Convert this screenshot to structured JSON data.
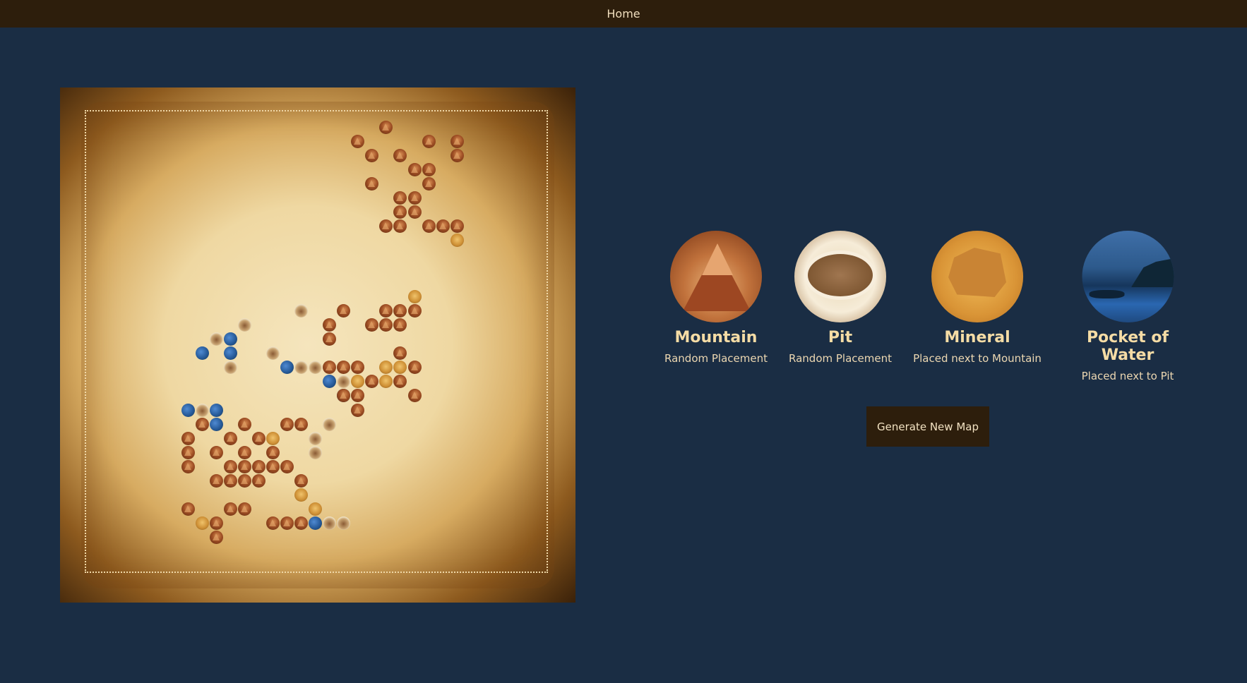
{
  "nav": {
    "home_label": "Home"
  },
  "map": {
    "tiles": [
      {
        "t": "mountain",
        "c": 18,
        "r": 0
      },
      {
        "t": "mountain",
        "c": 16,
        "r": 1
      },
      {
        "t": "mountain",
        "c": 21,
        "r": 1
      },
      {
        "t": "mountain",
        "c": 23,
        "r": 1
      },
      {
        "t": "mountain",
        "c": 17,
        "r": 2
      },
      {
        "t": "mountain",
        "c": 19,
        "r": 2
      },
      {
        "t": "mountain",
        "c": 23,
        "r": 2
      },
      {
        "t": "mountain",
        "c": 20,
        "r": 3
      },
      {
        "t": "mountain",
        "c": 21,
        "r": 3
      },
      {
        "t": "mountain",
        "c": 17,
        "r": 4
      },
      {
        "t": "mountain",
        "c": 21,
        "r": 4
      },
      {
        "t": "mountain",
        "c": 19,
        "r": 5
      },
      {
        "t": "mountain",
        "c": 20,
        "r": 5
      },
      {
        "t": "mountain",
        "c": 19,
        "r": 6
      },
      {
        "t": "mountain",
        "c": 20,
        "r": 6
      },
      {
        "t": "mountain",
        "c": 18,
        "r": 7
      },
      {
        "t": "mountain",
        "c": 19,
        "r": 7
      },
      {
        "t": "mountain",
        "c": 21,
        "r": 7
      },
      {
        "t": "mountain",
        "c": 22,
        "r": 7
      },
      {
        "t": "mountain",
        "c": 23,
        "r": 7
      },
      {
        "t": "mineral",
        "c": 23,
        "r": 8
      },
      {
        "t": "mineral",
        "c": 20,
        "r": 12
      },
      {
        "t": "pit",
        "c": 12,
        "r": 13
      },
      {
        "t": "mountain",
        "c": 15,
        "r": 13
      },
      {
        "t": "mountain",
        "c": 18,
        "r": 13
      },
      {
        "t": "mountain",
        "c": 19,
        "r": 13
      },
      {
        "t": "mountain",
        "c": 20,
        "r": 13
      },
      {
        "t": "pit",
        "c": 8,
        "r": 14
      },
      {
        "t": "mountain",
        "c": 14,
        "r": 14
      },
      {
        "t": "mountain",
        "c": 17,
        "r": 14
      },
      {
        "t": "mountain",
        "c": 18,
        "r": 14
      },
      {
        "t": "mountain",
        "c": 19,
        "r": 14
      },
      {
        "t": "pit",
        "c": 6,
        "r": 15
      },
      {
        "t": "water",
        "c": 7,
        "r": 15
      },
      {
        "t": "mountain",
        "c": 14,
        "r": 15
      },
      {
        "t": "water",
        "c": 5,
        "r": 16
      },
      {
        "t": "water",
        "c": 7,
        "r": 16
      },
      {
        "t": "pit",
        "c": 10,
        "r": 16
      },
      {
        "t": "mountain",
        "c": 19,
        "r": 16
      },
      {
        "t": "pit",
        "c": 7,
        "r": 17
      },
      {
        "t": "water",
        "c": 11,
        "r": 17
      },
      {
        "t": "pit",
        "c": 12,
        "r": 17
      },
      {
        "t": "pit",
        "c": 13,
        "r": 17
      },
      {
        "t": "mountain",
        "c": 14,
        "r": 17
      },
      {
        "t": "mountain",
        "c": 15,
        "r": 17
      },
      {
        "t": "mountain",
        "c": 16,
        "r": 17
      },
      {
        "t": "mineral",
        "c": 18,
        "r": 17
      },
      {
        "t": "mineral",
        "c": 19,
        "r": 17
      },
      {
        "t": "mountain",
        "c": 20,
        "r": 17
      },
      {
        "t": "water",
        "c": 14,
        "r": 18
      },
      {
        "t": "pit",
        "c": 15,
        "r": 18
      },
      {
        "t": "mineral",
        "c": 16,
        "r": 18
      },
      {
        "t": "mountain",
        "c": 17,
        "r": 18
      },
      {
        "t": "mineral",
        "c": 18,
        "r": 18
      },
      {
        "t": "mountain",
        "c": 19,
        "r": 18
      },
      {
        "t": "water",
        "c": 15,
        "r": 19
      },
      {
        "t": "mountain",
        "c": 15,
        "r": 19
      },
      {
        "t": "mountain",
        "c": 16,
        "r": 19
      },
      {
        "t": "mountain",
        "c": 20,
        "r": 19
      },
      {
        "t": "water",
        "c": 4,
        "r": 20
      },
      {
        "t": "pit",
        "c": 5,
        "r": 20
      },
      {
        "t": "water",
        "c": 6,
        "r": 20
      },
      {
        "t": "mountain",
        "c": 16,
        "r": 20
      },
      {
        "t": "mountain",
        "c": 5,
        "r": 21
      },
      {
        "t": "water",
        "c": 6,
        "r": 21
      },
      {
        "t": "mountain",
        "c": 8,
        "r": 21
      },
      {
        "t": "mountain",
        "c": 11,
        "r": 21
      },
      {
        "t": "mountain",
        "c": 12,
        "r": 21
      },
      {
        "t": "pit",
        "c": 14,
        "r": 21
      },
      {
        "t": "mountain",
        "c": 4,
        "r": 22
      },
      {
        "t": "mountain",
        "c": 7,
        "r": 22
      },
      {
        "t": "mountain",
        "c": 9,
        "r": 22
      },
      {
        "t": "mineral",
        "c": 10,
        "r": 22
      },
      {
        "t": "pit",
        "c": 13,
        "r": 22
      },
      {
        "t": "mountain",
        "c": 4,
        "r": 23
      },
      {
        "t": "mountain",
        "c": 6,
        "r": 23
      },
      {
        "t": "mountain",
        "c": 8,
        "r": 23
      },
      {
        "t": "mountain",
        "c": 10,
        "r": 23
      },
      {
        "t": "pit",
        "c": 13,
        "r": 23
      },
      {
        "t": "mountain",
        "c": 4,
        "r": 24
      },
      {
        "t": "mountain",
        "c": 7,
        "r": 24
      },
      {
        "t": "mountain",
        "c": 8,
        "r": 24
      },
      {
        "t": "mountain",
        "c": 9,
        "r": 24
      },
      {
        "t": "mountain",
        "c": 10,
        "r": 24
      },
      {
        "t": "mountain",
        "c": 11,
        "r": 24
      },
      {
        "t": "mountain",
        "c": 6,
        "r": 25
      },
      {
        "t": "mountain",
        "c": 7,
        "r": 25
      },
      {
        "t": "mountain",
        "c": 8,
        "r": 25
      },
      {
        "t": "mountain",
        "c": 9,
        "r": 25
      },
      {
        "t": "mountain",
        "c": 12,
        "r": 25
      },
      {
        "t": "mineral",
        "c": 12,
        "r": 26
      },
      {
        "t": "mountain",
        "c": 4,
        "r": 27
      },
      {
        "t": "mountain",
        "c": 7,
        "r": 27
      },
      {
        "t": "mountain",
        "c": 8,
        "r": 27
      },
      {
        "t": "mineral",
        "c": 13,
        "r": 27
      },
      {
        "t": "mineral",
        "c": 5,
        "r": 28
      },
      {
        "t": "mountain",
        "c": 6,
        "r": 28
      },
      {
        "t": "mountain",
        "c": 10,
        "r": 28
      },
      {
        "t": "mountain",
        "c": 11,
        "r": 28
      },
      {
        "t": "mountain",
        "c": 12,
        "r": 28
      },
      {
        "t": "water",
        "c": 13,
        "r": 28
      },
      {
        "t": "pit",
        "c": 14,
        "r": 28
      },
      {
        "t": "pit",
        "c": 15,
        "r": 28
      },
      {
        "t": "mountain",
        "c": 6,
        "r": 29
      }
    ]
  },
  "legend": [
    {
      "name": "Mountain",
      "rule": "Random Placement",
      "icon": "mountain-icon"
    },
    {
      "name": "Pit",
      "rule": "Random Placement",
      "icon": "pit-icon"
    },
    {
      "name": "Mineral",
      "rule": "Placed next to Mountain",
      "icon": "mineral-icon"
    },
    {
      "name": "Pocket of Water",
      "rule": "Placed next to Pit",
      "icon": "water-icon"
    }
  ],
  "actions": {
    "generate_label": "Generate New Map"
  },
  "colors": {
    "page_bg": "#1a2d44",
    "bar_bg": "#2d1e0c",
    "legend_title": "#f5dca5"
  }
}
